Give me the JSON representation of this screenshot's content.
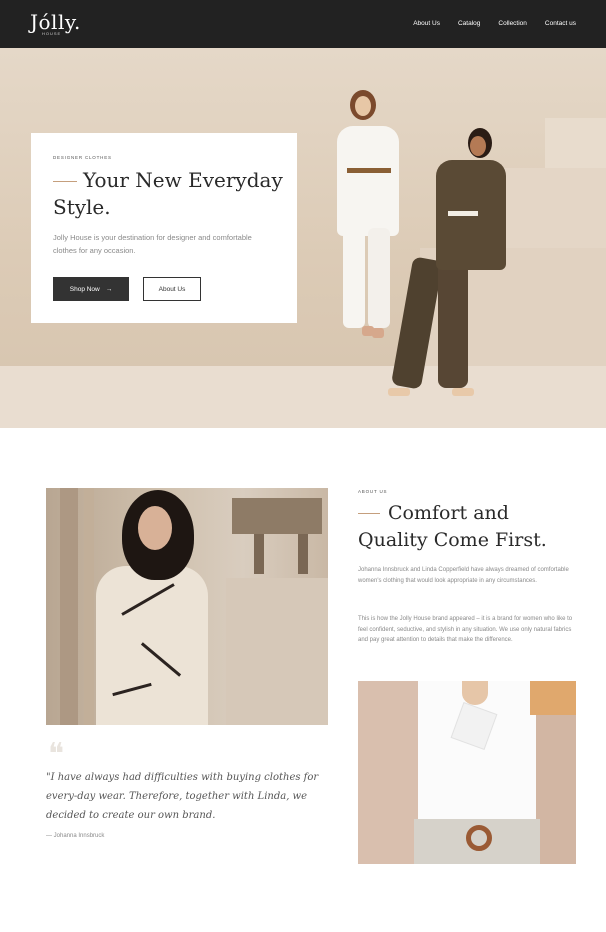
{
  "header": {
    "logo": "Jólly.",
    "logo_sub": "HOUSE",
    "nav": [
      "About Us",
      "Catalog",
      "Collection",
      "Contact us"
    ]
  },
  "hero": {
    "eyebrow": "DESIGNER CLOTHES",
    "title": "Your New Everyday Style.",
    "description": "Jolly House is your destination for designer and comfortable clothes for any occasion.",
    "primary_button": "Shop Now",
    "primary_button_icon": "arrow-right-icon",
    "secondary_button": "About Us"
  },
  "about": {
    "eyebrow": "ABOUT US",
    "title": "Comfort and Quality Come First.",
    "paragraph1": "Johanna Innsbruck and Linda Copperfield have always dreamed of comfortable women's clothing that would look appropriate in any circumstances.",
    "paragraph2": "This is how the Jolly House brand appeared – it is a brand for women who like to feel confident, seductive, and stylish in any situation. We use only natural fabrics and pay great attention to details that make the difference.",
    "quote_icon": "quote-icon",
    "quote": "\"I have always had difficulties with buying clothes for every-day wear. Therefore, together with Linda, we decided to create our own brand.",
    "quote_author": "— Johanna Innsbruck"
  },
  "colors": {
    "header_bg": "#222222",
    "accent": "#c59f7d",
    "button_dark": "#333333"
  }
}
